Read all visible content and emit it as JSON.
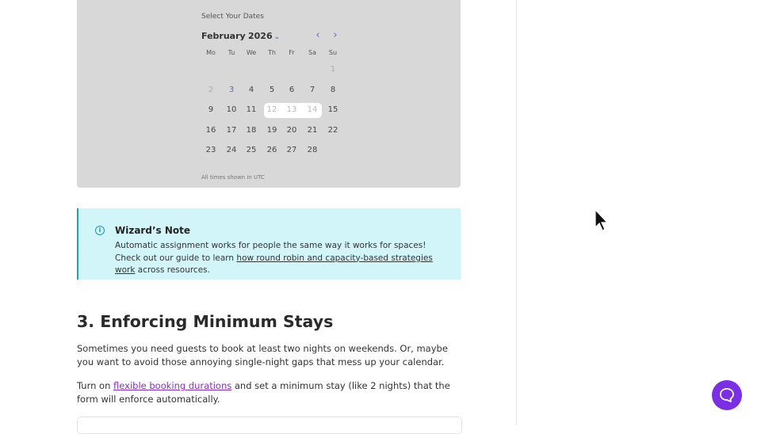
{
  "calendar": {
    "label": "Select Your Dates",
    "month": "February",
    "year": "2026",
    "weekdays": [
      "Mo",
      "Tu",
      "We",
      "Th",
      "Fr",
      "Sa",
      "Su"
    ],
    "weeks": [
      [
        "",
        "",
        "",
        "",
        "",
        "",
        "1"
      ],
      [
        "2",
        "3",
        "4",
        "5",
        "6",
        "7",
        "8"
      ],
      [
        "9",
        "10",
        "11",
        "12",
        "13",
        "14",
        "15"
      ],
      [
        "16",
        "17",
        "18",
        "19",
        "20",
        "21",
        "22"
      ],
      [
        "23",
        "24",
        "25",
        "26",
        "27",
        "28",
        ""
      ]
    ],
    "today": "3",
    "booked_days": [
      "12",
      "13",
      "14"
    ],
    "footer": "All times shown in UTC",
    "accent_color": "#4a6fd6"
  },
  "note": {
    "title": "Wizard’s Note",
    "body_prefix": "Automatic assignment works for people the same way it works for spaces! Check out our guide to learn ",
    "link_text": "how round robin and capacity-based strategies work",
    "body_suffix": " across resources."
  },
  "section": {
    "heading": "3. Enforcing Minimum Stays",
    "para1": "Sometimes you need guests to book at least two nights on weekends. Or, maybe you want to avoid those annoying single-night gaps that mess up your calendar.",
    "para2_prefix": "Turn on ",
    "para2_link": "flexible booking durations",
    "para2_suffix": " and set a minimum stay (like 2 nights) that the form will enforce automatically."
  },
  "chat": {
    "icon": "chat-bubble-icon",
    "color": "#7a2ee6"
  }
}
